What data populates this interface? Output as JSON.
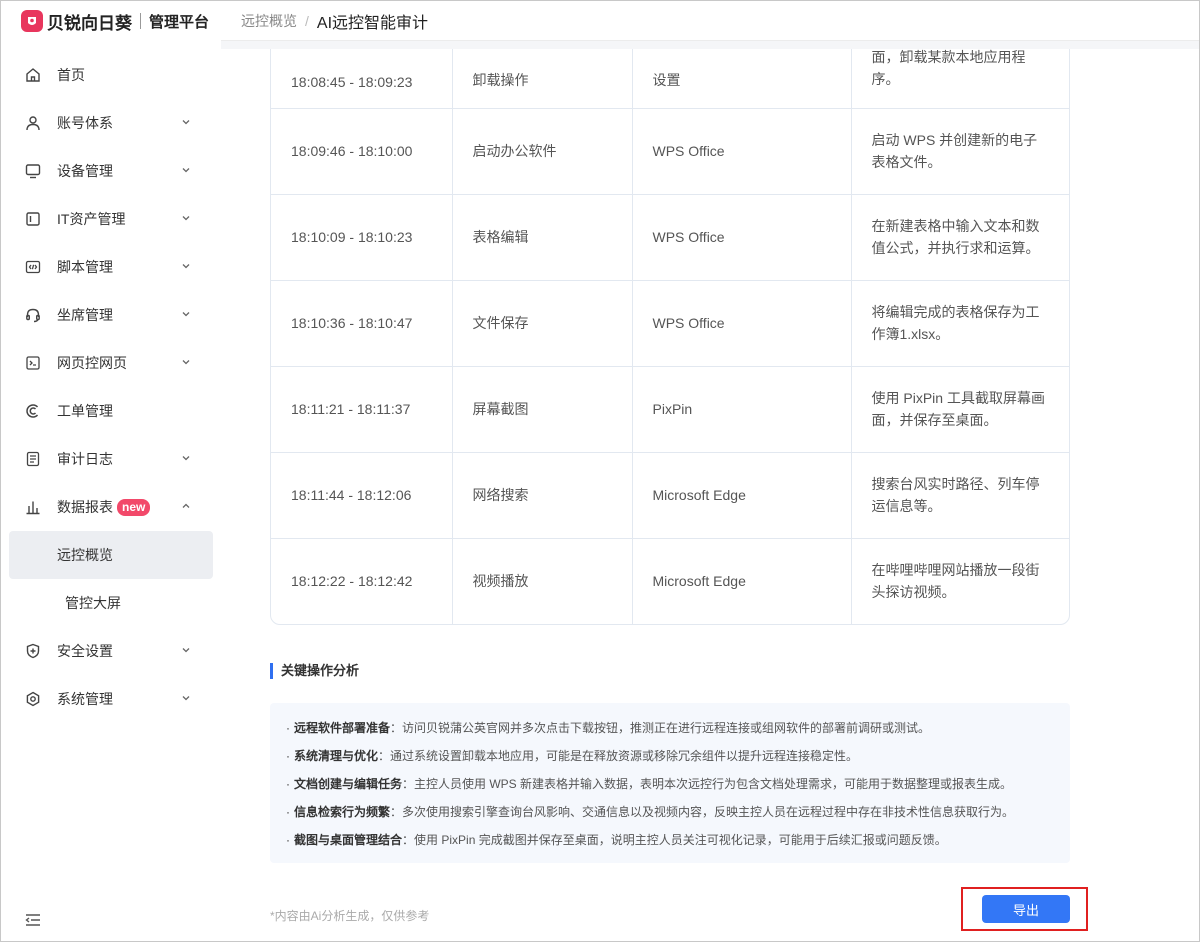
{
  "brand": {
    "name": "贝锐向日葵",
    "sub": "管理平台"
  },
  "breadcrumb": {
    "parent": "远控概览",
    "current": "AI远控智能审计"
  },
  "sidebar": {
    "items": [
      {
        "label": "首页",
        "icon": "home-icon"
      },
      {
        "label": "账号体系",
        "icon": "user-icon"
      },
      {
        "label": "设备管理",
        "icon": "monitor-icon"
      },
      {
        "label": "IT资产管理",
        "icon": "server-icon"
      },
      {
        "label": "脚本管理",
        "icon": "code-icon"
      },
      {
        "label": "坐席管理",
        "icon": "headset-icon"
      },
      {
        "label": "网页控网页",
        "icon": "web-terminal-icon"
      },
      {
        "label": "工单管理",
        "icon": "ticket-icon"
      },
      {
        "label": "审计日志",
        "icon": "log-icon"
      },
      {
        "label": "数据报表",
        "icon": "bar-chart-icon",
        "badge": "new"
      }
    ],
    "sub_items": [
      {
        "label": "远控概览",
        "active": true
      },
      {
        "label": "管控大屏",
        "active": false
      }
    ],
    "bottom_items": [
      {
        "label": "安全设置",
        "icon": "shield-icon"
      },
      {
        "label": "系统管理",
        "icon": "gear-icon"
      }
    ]
  },
  "table": {
    "rows": [
      {
        "time": "18:08:45 - 18:09:23",
        "action": "卸载操作",
        "app": "设置",
        "desc_1": "面，卸载某款本地应用程",
        "desc_2": "序。"
      },
      {
        "time": "18:09:46 - 18:10:00",
        "action": "启动办公软件",
        "app": "WPS Office",
        "desc_1": "启动 WPS 并创建新的电子",
        "desc_2": "表格文件。"
      },
      {
        "time": "18:10:09 - 18:10:23",
        "action": "表格编辑",
        "app": "WPS Office",
        "desc_1": "在新建表格中输入文本和数",
        "desc_2": "值公式，并执行求和运算。"
      },
      {
        "time": "18:10:36 - 18:10:47",
        "action": "文件保存",
        "app": "WPS Office",
        "desc_1": "将编辑完成的表格保存为工",
        "desc_2": "作簿1.xlsx。"
      },
      {
        "time": "18:11:21 - 18:11:37",
        "action": "屏幕截图",
        "app": "PixPin",
        "desc_1": "使用 PixPin 工具截取屏幕画",
        "desc_2": "面，并保存至桌面。"
      },
      {
        "time": "18:11:44 - 18:12:06",
        "action": "网络搜索",
        "app": "Microsoft Edge",
        "desc_1": "搜索台风实时路径、列车停",
        "desc_2": "运信息等。"
      },
      {
        "time": "18:12:22 - 18:12:42",
        "action": "视频播放",
        "app": "Microsoft Edge",
        "desc_1": "在哔哩哔哩网站播放一段街",
        "desc_2": "头探访视频。"
      }
    ]
  },
  "analysis": {
    "title": "关键操作分析",
    "points": [
      {
        "label": "远程软件部署准备",
        "text": "：访问贝锐蒲公英官网并多次点击下载按钮，推测正在进行远程连接或组网软件的部署前调研或测试。"
      },
      {
        "label": "系统清理与优化",
        "text": "：通过系统设置卸载本地应用，可能是在释放资源或移除冗余组件以提升远程连接稳定性。"
      },
      {
        "label": "文档创建与编辑任务",
        "text": "：主控人员使用 WPS 新建表格并输入数据，表明本次远控行为包含文档处理需求，可能用于数据整理或报表生成。"
      },
      {
        "label": "信息检索行为频繁",
        "text": "：多次使用搜索引擎查询台风影响、交通信息以及视频内容，反映主控人员在远程过程中存在非技术性信息获取行为。"
      },
      {
        "label": "截图与桌面管理结合",
        "text": "：使用 PixPin 完成截图并保存至桌面，说明主控人员关注可视化记录，可能用于后续汇报或问题反馈。"
      }
    ]
  },
  "footnote": "*内容由Ai分析生成，仅供参考",
  "export_label": "导出",
  "colors": {
    "accent": "#3377f6",
    "brand": "#e8365d",
    "badge": "#f2496a",
    "highlight_border": "#e02020"
  }
}
